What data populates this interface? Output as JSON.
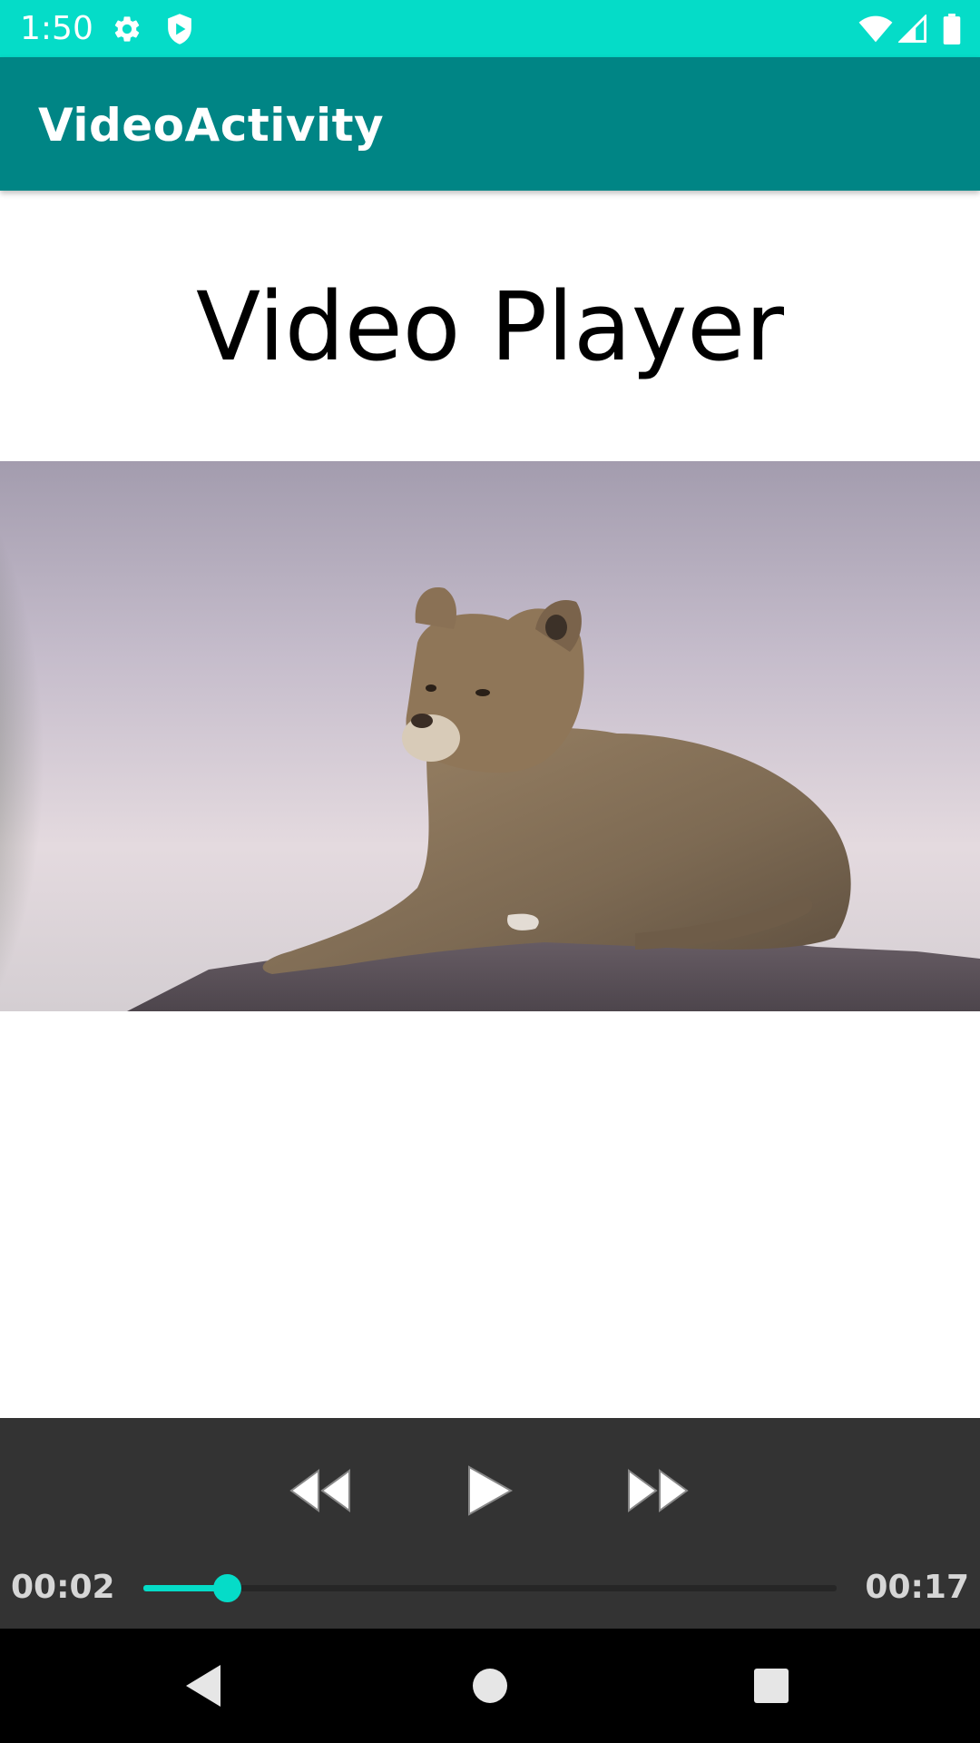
{
  "status_bar": {
    "time": "1:50",
    "icons": [
      "settings-icon",
      "shield-icon",
      "wifi-icon",
      "cell-signal-icon",
      "battery-icon"
    ],
    "background": "#05DCC8"
  },
  "app_bar": {
    "title": "VideoActivity",
    "background": "#008585"
  },
  "main": {
    "heading": "Video Player"
  },
  "video": {
    "content_description": ""
  },
  "controller": {
    "buttons": [
      "rewind-icon",
      "play-icon",
      "fast-forward-icon"
    ],
    "current_time": "00:02",
    "total_time": "00:17",
    "progress_fraction": 0.12,
    "accent": "#05DCC8",
    "background": "#333333"
  },
  "nav_bar": {
    "buttons": [
      "back-icon",
      "home-icon",
      "recents-icon"
    ]
  }
}
